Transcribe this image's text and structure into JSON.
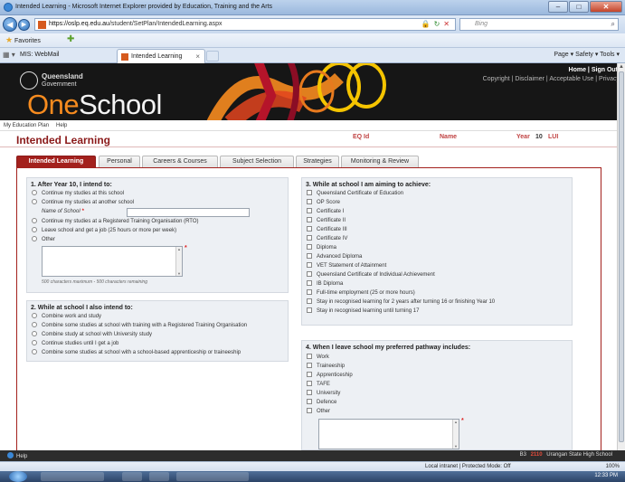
{
  "window": {
    "title": "Intended Learning - Microsoft Internet Explorer provided by Education, Training and the Arts",
    "minimize": "–",
    "maximize": "□",
    "close": "✕"
  },
  "browser": {
    "url_host": "https://oslp.eq.edu.au",
    "url_path": "/student/SetPlan/IntendedLearning.aspx",
    "search_placeholder": "Bing",
    "favorites_label": "Favorites",
    "mis_label": "MIS: WebMail",
    "tab_label": "Intended Learning",
    "tab_close": "×",
    "command_bar": "Page ▾   Safety ▾   Tools ▾",
    "zone_text": "Local intranet | Protected Mode: Off",
    "zoom_text": "100%",
    "clock": "12:33 PM"
  },
  "banner": {
    "gov_title": "Queensland",
    "gov_sub": "Government",
    "logo_one": "One",
    "logo_school": "School",
    "top_links": "Home | Sign Out",
    "bottom_links": "Copyright | Disclaimer | Acceptable Use | Privacy"
  },
  "app_menu": {
    "item1": "My Education Plan",
    "item2": "Help"
  },
  "page": {
    "title": "Intended Learning",
    "eq_id_label": "EQ Id",
    "name_label": "Name",
    "year_label": "Year",
    "year_value": "10",
    "lui_label": "LUI"
  },
  "tabs": [
    {
      "label": "Intended Learning"
    },
    {
      "label": "Personal"
    },
    {
      "label": "Careers & Courses"
    },
    {
      "label": "Subject Selection"
    },
    {
      "label": "Strategies"
    },
    {
      "label": "Monitoring & Review"
    }
  ],
  "section1": {
    "heading": "1. After Year 10, I intend to:",
    "options": [
      "Continue my studies at this school",
      "Continue my studies at another school",
      "Continue my studies at a Registered Training Organisation (RTO)",
      "Leave school and get a job (25 hours or more per week)",
      "Other"
    ],
    "school_name_label": "Name of School",
    "required_mark": "*",
    "counter": "500 characters maximum - 500 characters remaining"
  },
  "section2": {
    "heading": "2. While at school I also intend to:",
    "options": [
      "Combine work and study",
      "Combine some studies at school with training with a Registered Training Organisation",
      "Combine study at school with University study",
      "Continue studies until I get a job",
      "Combine some studies at school with a school-based apprenticeship or traineeship"
    ]
  },
  "section3": {
    "heading": "3. While at school I am aiming to achieve:",
    "options": [
      "Queensland Certificate of Education",
      "OP Score",
      "Certificate I",
      "Certificate II",
      "Certificate III",
      "Certificate IV",
      "Diploma",
      "Advanced Diploma",
      "VET Statement of Attainment",
      "Queensland Certificate of Individual Achievement",
      "IB Diploma",
      "Full-time employment (25 or more hours)",
      "Stay in recognised learning for 2 years after turning 16 or finishing Year 10",
      "Stay in recognised learning until turning 17"
    ]
  },
  "section4": {
    "heading": "4. When I leave school my preferred pathway includes:",
    "options": [
      "Work",
      "Traineeship",
      "Apprenticeship",
      "TAFE",
      "University",
      "Defence",
      "Other"
    ],
    "required_mark": "*"
  },
  "status": {
    "help": "Help",
    "code1": "B3",
    "code2": "2110",
    "school": "Urangan State High School"
  }
}
